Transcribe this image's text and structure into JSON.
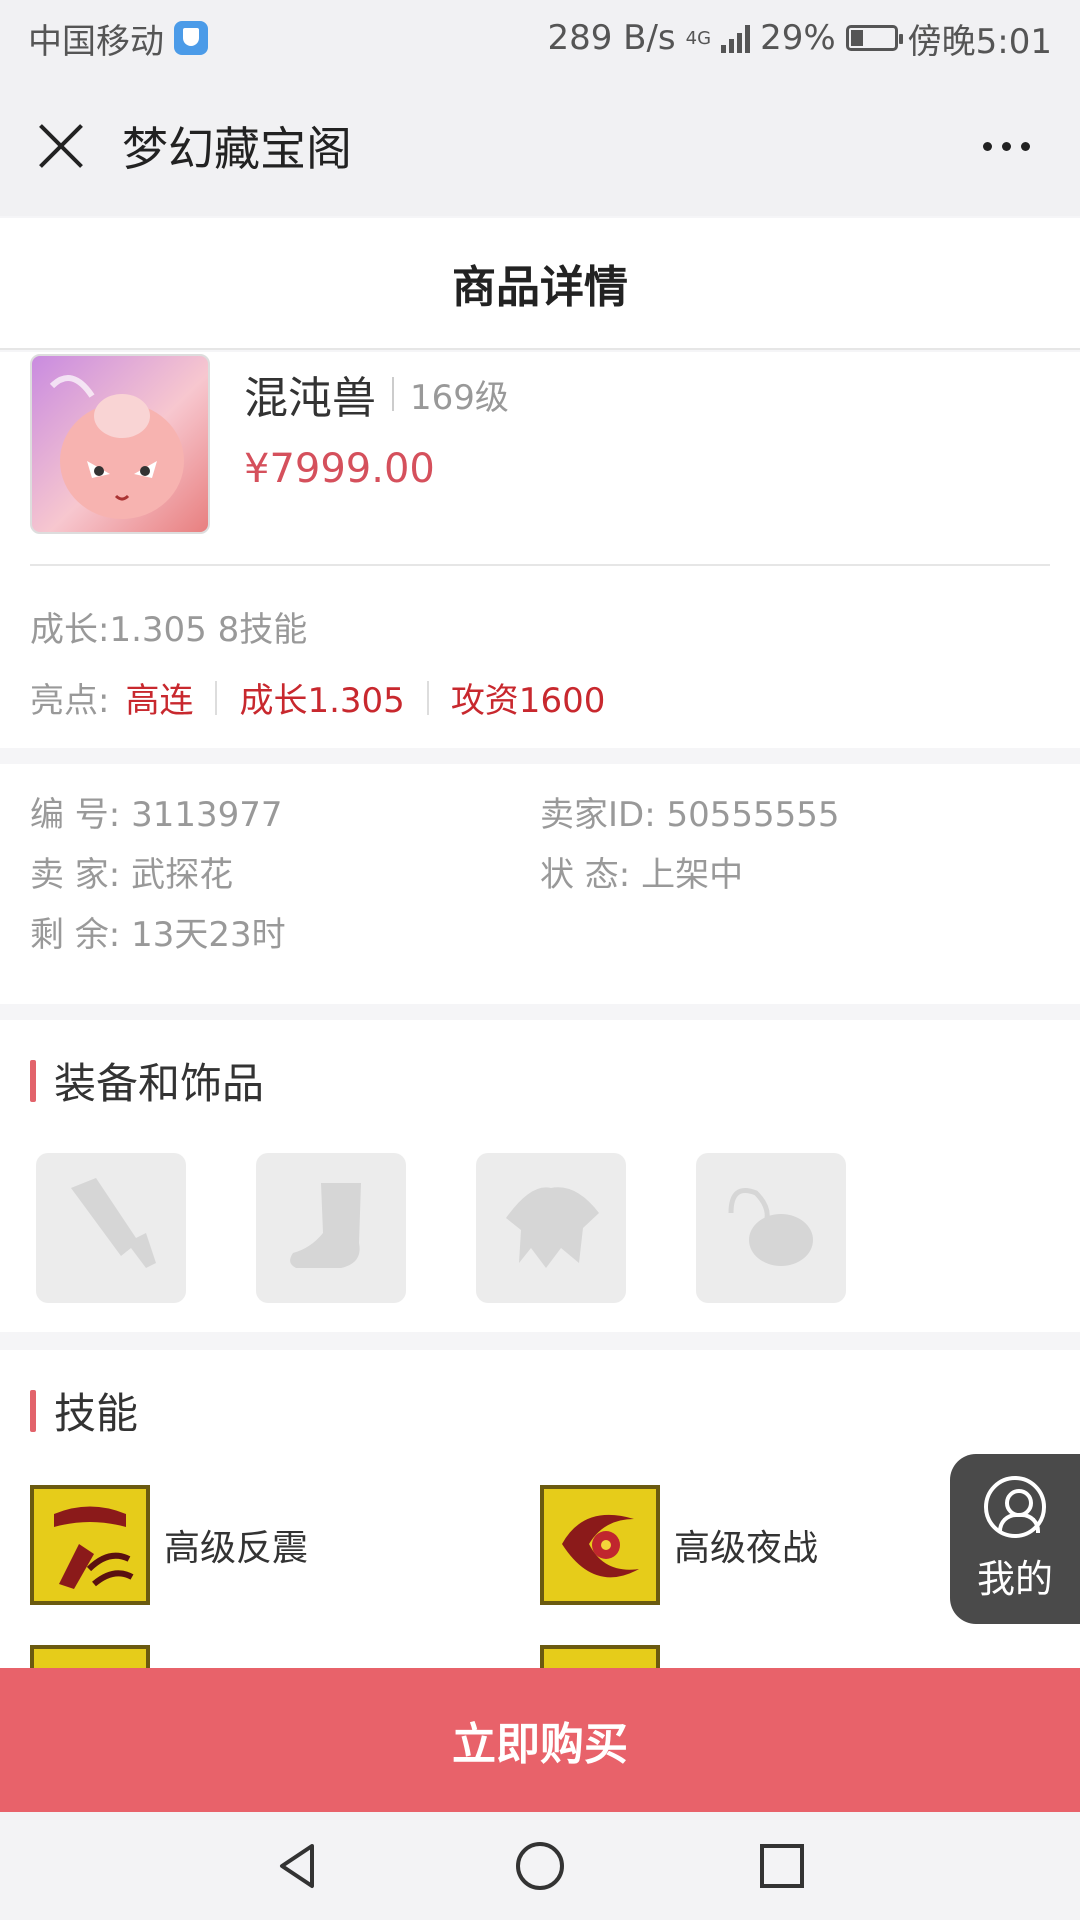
{
  "status_bar": {
    "carrier": "中国移动",
    "speed": "289 B/s",
    "network": "4G",
    "battery": "29%",
    "time": "傍晚5:01"
  },
  "title_bar": {
    "title": "梦幻藏宝阁"
  },
  "page": {
    "title": "商品详情"
  },
  "product": {
    "name": "混沌兽",
    "level": "169级",
    "price": "¥7999.00",
    "growth_line": "成长:1.305 8技能",
    "highlights_label": "亮点:",
    "highlights": [
      "高连",
      "成长1.305",
      "攻资1600"
    ]
  },
  "info": {
    "number": "编 号: 3113977",
    "seller_id": "卖家ID: 50555555",
    "seller": "卖 家: 武探花",
    "status": "状 态: 上架中",
    "remaining": "剩 余: 13天23时"
  },
  "equipment": {
    "title": "装备和饰品",
    "slots": [
      "sword-icon",
      "boot-icon",
      "armor-icon",
      "pendant-icon"
    ]
  },
  "skills": {
    "title": "技能",
    "items": [
      {
        "name": "高级反震"
      },
      {
        "name": "高级夜战"
      }
    ]
  },
  "float_button": {
    "label": "我的"
  },
  "buy": {
    "label": "立即购买"
  },
  "colors": {
    "accent": "#e8626a",
    "price": "#d5505c",
    "highlight": "#c8282e"
  }
}
